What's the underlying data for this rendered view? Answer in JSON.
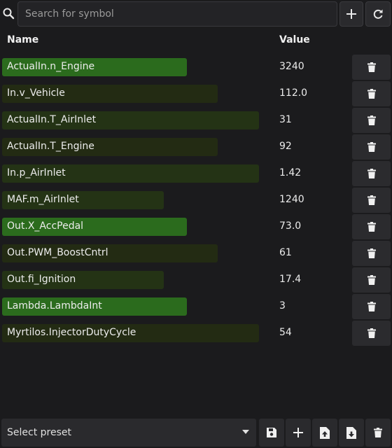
{
  "search": {
    "placeholder": "Search for symbol",
    "value": ""
  },
  "toolbar": {
    "add_icon": "plus-icon",
    "refresh_icon": "refresh-icon"
  },
  "table": {
    "headers": {
      "name": "Name",
      "value": "Value"
    },
    "rows": [
      {
        "name": "ActualIn.n_Engine",
        "value": "3240",
        "level": 0.72,
        "color": "#2b6b1d"
      },
      {
        "name": "In.v_Vehicle",
        "value": "112.0",
        "level": 0.84,
        "color": "#232b13"
      },
      {
        "name": "ActualIn.T_AirInlet",
        "value": "31",
        "level": 1.0,
        "color": "#243315"
      },
      {
        "name": "ActualIn.T_Engine",
        "value": "92",
        "level": 0.84,
        "color": "#232b13"
      },
      {
        "name": "In.p_AirInlet",
        "value": "1.42",
        "level": 1.0,
        "color": "#243315"
      },
      {
        "name": "MAF.m_AirInlet",
        "value": "1240",
        "level": 0.63,
        "color": "#243315"
      },
      {
        "name": "Out.X_AccPedal",
        "value": "73.0",
        "level": 0.72,
        "color": "#2b6b1d"
      },
      {
        "name": "Out.PWM_BoostCntrl",
        "value": "61",
        "level": 0.84,
        "color": "#232b13"
      },
      {
        "name": "Out.fi_Ignition",
        "value": "17.4",
        "level": 0.63,
        "color": "#243315"
      },
      {
        "name": "Lambda.LambdaInt",
        "value": "3",
        "level": 0.72,
        "color": "#2b6b1d"
      },
      {
        "name": "Myrtilos.InjectorDutyCycle",
        "value": "54",
        "level": 1.0,
        "color": "#232b13"
      }
    ],
    "delete_icon": "trash-icon"
  },
  "footer": {
    "preset_label": "Select preset",
    "preset_icon": "caret-down-icon",
    "save_icon": "save-icon",
    "add_icon": "plus-icon",
    "upload_icon": "file-upload-icon",
    "download_icon": "file-download-icon",
    "delete_icon": "trash-icon"
  },
  "colors": {
    "background": "#1b1b1d",
    "bright_green": "#2b6b1d",
    "dark_green": "#243315",
    "darker_green": "#232b13",
    "button": "#2b2b2e"
  }
}
